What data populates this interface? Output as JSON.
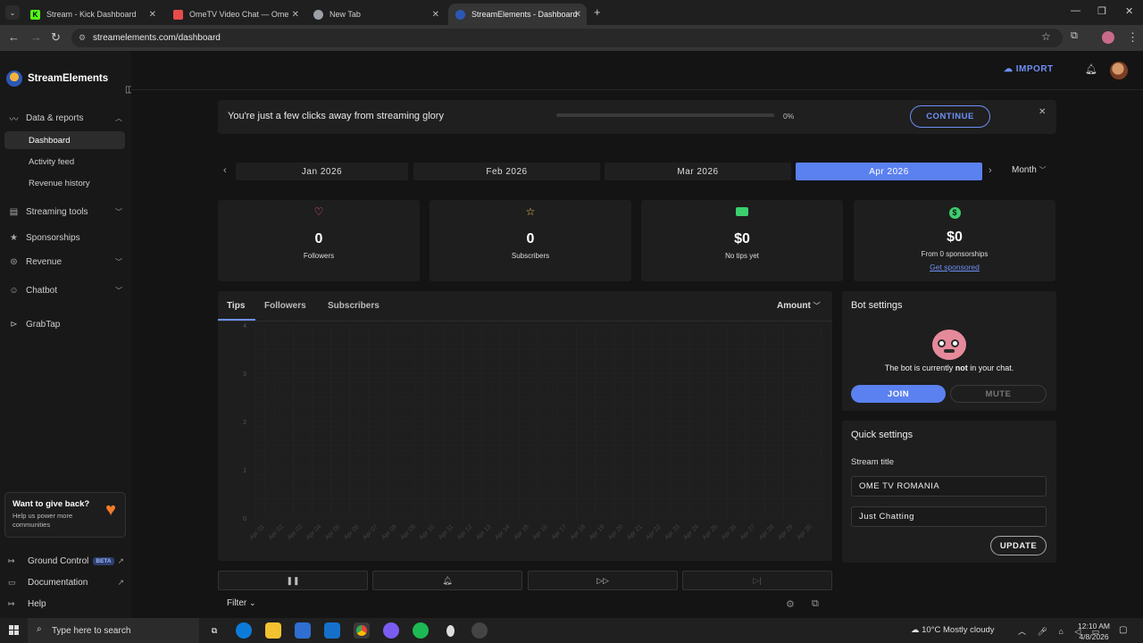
{
  "browser": {
    "tabs": [
      {
        "title": "Stream - Kick Dashboard",
        "color": "#53fc18",
        "glyph": "K"
      },
      {
        "title": "OmeTV Video Chat — Ome",
        "color": "#e94b4b",
        "glyph": "●"
      },
      {
        "title": "New Tab",
        "color": "#9aa0a6",
        "glyph": "◎"
      },
      {
        "title": "StreamElements - Dashboard",
        "color": "#2b58b5",
        "glyph": "◉"
      }
    ],
    "url": "streamelements.com/dashboard"
  },
  "sidebar": {
    "brand": "StreamElements",
    "sections": {
      "data_reports": "Data & reports",
      "streaming_tools": "Streaming tools",
      "sponsorships": "Sponsorships",
      "revenue": "Revenue",
      "chatbot": "Chatbot",
      "grabtap": "GrabTap"
    },
    "sub": {
      "dashboard": "Dashboard",
      "activity_feed": "Activity feed",
      "revenue_history": "Revenue history"
    },
    "give_back": {
      "title": "Want to give back?",
      "text": "Help us power more communities"
    },
    "footer": {
      "ground_control": "Ground Control",
      "beta": "BETA",
      "documentation": "Documentation",
      "help": "Help"
    }
  },
  "topbar": {
    "import": "IMPORT"
  },
  "banner": {
    "text": "You're just a few clicks away from streaming glory",
    "progress": 0,
    "progress_label": "0%",
    "cta": "CONTINUE"
  },
  "months": [
    "Jan 2026",
    "Feb 2026",
    "Mar 2026",
    "Apr 2026"
  ],
  "active_month": "Apr 2026",
  "period": "Month",
  "stats": [
    {
      "value": "0",
      "label": "Followers",
      "icon": "heart-icon",
      "color": "#f05a7e"
    },
    {
      "value": "0",
      "label": "Subscribers",
      "icon": "star-icon",
      "color": "#f2c94c"
    },
    {
      "value": "$0",
      "label": "No tips yet",
      "icon": "cash-icon",
      "color": "#3ccf6e"
    },
    {
      "value": "$0",
      "label": "From 0 sponsorships",
      "icon": "dollar-icon",
      "color": "#3ccf6e",
      "link": "Get sponsored"
    }
  ],
  "chart": {
    "tabs": [
      "Tips",
      "Followers",
      "Subscribers"
    ],
    "active_tab": "Tips",
    "metric": "Amount"
  },
  "chart_data": {
    "type": "bar",
    "categories": [
      "Apr 01",
      "Apr 02",
      "Apr 03",
      "Apr 04",
      "Apr 05",
      "Apr 06",
      "Apr 07",
      "Apr 08",
      "Apr 09",
      "Apr 10",
      "Apr 11",
      "Apr 12",
      "Apr 13",
      "Apr 14",
      "Apr 15",
      "Apr 16",
      "Apr 17",
      "Apr 18",
      "Apr 19",
      "Apr 20",
      "Apr 21",
      "Apr 22",
      "Apr 23",
      "Apr 24",
      "Apr 25",
      "Apr 26",
      "Apr 27",
      "Apr 28",
      "Apr 29",
      "Apr 30"
    ],
    "values": [
      0,
      0,
      0,
      0,
      0,
      0,
      0,
      0,
      0,
      0,
      0,
      0,
      0,
      0,
      0,
      0,
      0,
      0,
      0,
      0,
      0,
      0,
      0,
      0,
      0,
      0,
      0,
      0,
      0,
      0
    ],
    "yticks": [
      "4",
      "3",
      "2",
      "1",
      "0"
    ],
    "ylim": [
      0,
      4
    ],
    "grid": true,
    "title": "",
    "xlabel": "",
    "ylabel": ""
  },
  "bot": {
    "title": "Bot settings",
    "status_pre": "The bot is currently ",
    "status_em": "not",
    "status_post": " in your chat.",
    "join": "JOIN",
    "mute": "MUTE"
  },
  "quick": {
    "title": "Quick settings",
    "stream_title_label": "Stream title",
    "stream_title": "OME TV ROMANIA",
    "category": "Just Chatting",
    "update": "UPDATE"
  },
  "footer_controls": {
    "filter": "Filter"
  },
  "taskbar": {
    "search_placeholder": "Type here to search",
    "weather": "10°C  Mostly cloudy",
    "time": "12:10 AM",
    "date": "4/8/2026"
  }
}
